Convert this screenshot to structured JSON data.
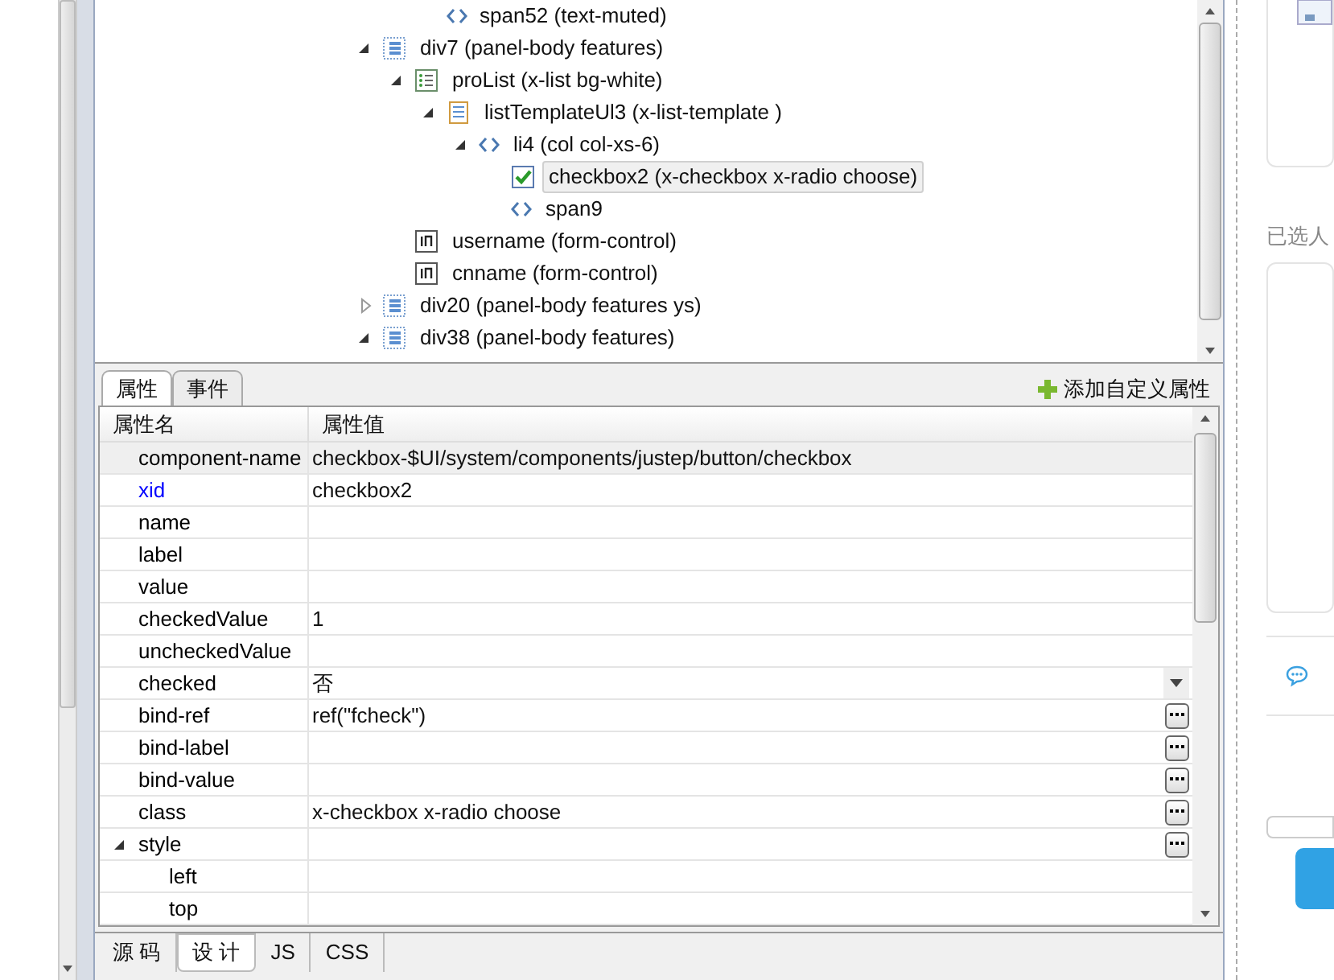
{
  "tree": {
    "above": [
      {
        "label": "span52 (text-muted)",
        "kind": "tag",
        "selected": false
      }
    ],
    "items": [
      {
        "label": "div7 (panel-body features)",
        "kind": "panel",
        "expanded": true,
        "selected": false,
        "children": [
          {
            "label": "proList (x-list bg-white)",
            "kind": "list",
            "expanded": true,
            "selected": false,
            "children": [
              {
                "label": "listTemplateUl3 (x-list-template )",
                "kind": "template",
                "expanded": true,
                "selected": false,
                "children": [
                  {
                    "label": "li4 (col col-xs-6)",
                    "kind": "tag",
                    "expanded": true,
                    "selected": false,
                    "children": [
                      {
                        "label": "checkbox2 (x-checkbox x-radio choose)",
                        "kind": "checkbox",
                        "selected": true
                      },
                      {
                        "label": "span9",
                        "kind": "tag",
                        "selected": false
                      }
                    ]
                  }
                ]
              }
            ]
          },
          {
            "label": "username (form-control)",
            "kind": "input",
            "selected": false
          },
          {
            "label": "cnname (form-control)",
            "kind": "input",
            "selected": false
          }
        ]
      },
      {
        "label": "div20 (panel-body features ys)",
        "kind": "panel",
        "expanded": false,
        "selected": false
      },
      {
        "label": "div38 (panel-body features)",
        "kind": "panel",
        "expanded": true,
        "selected": false
      }
    ]
  },
  "panel_tabs": [
    {
      "label": "属性",
      "selected": true
    },
    {
      "label": "事件",
      "selected": false
    }
  ],
  "add_button": "添加自定义属性",
  "table": {
    "columns": [
      "属性名",
      "属性值"
    ],
    "rows": [
      {
        "name": "component-name",
        "value": "checkbox-$UI/system/components/justep/button/checkbox",
        "color": "#000000",
        "selected": true,
        "kind": "text"
      },
      {
        "name": "xid",
        "value": "checkbox2",
        "color": "#0000ff",
        "selected": false,
        "kind": "text"
      },
      {
        "name": "name",
        "color": "#000000",
        "selected": false,
        "kind": "text"
      },
      {
        "name": "label",
        "color": "#000000",
        "selected": false,
        "kind": "text"
      },
      {
        "name": "value",
        "color": "#000000",
        "selected": false,
        "kind": "text"
      },
      {
        "name": "checkedValue",
        "value": "1",
        "color": "#000000",
        "selected": false,
        "kind": "text"
      },
      {
        "name": "uncheckedValue",
        "color": "#000000",
        "selected": false,
        "kind": "text"
      },
      {
        "name": "checked",
        "value": "否",
        "color": "#000000",
        "selected": false,
        "kind": "dropdown"
      },
      {
        "name": "bind-ref",
        "value": "ref(\"fcheck\")",
        "color": "#000000",
        "selected": false,
        "kind": "dialog"
      },
      {
        "name": "bind-label",
        "color": "#000000",
        "selected": false,
        "kind": "dialog"
      },
      {
        "name": "bind-value",
        "color": "#000000",
        "selected": false,
        "kind": "dialog"
      },
      {
        "name": "class",
        "value": "x-checkbox x-radio choose",
        "color": "#000000",
        "selected": false,
        "kind": "dialog"
      },
      {
        "name": "style",
        "color": "#000000",
        "selected": false,
        "kind": "dialog",
        "expanded": true,
        "children": [
          {
            "name": "left",
            "color": "#000000",
            "selected": false
          },
          {
            "name": "top",
            "color": "#000000",
            "selected": false
          }
        ]
      }
    ]
  },
  "bottom_tabs": [
    {
      "label": "源 码",
      "selected": false
    },
    {
      "label": "设 计",
      "selected": true
    },
    {
      "label": "JS",
      "selected": false
    },
    {
      "label": "CSS",
      "selected": false
    }
  ],
  "preview": {
    "heading": "已选人"
  }
}
